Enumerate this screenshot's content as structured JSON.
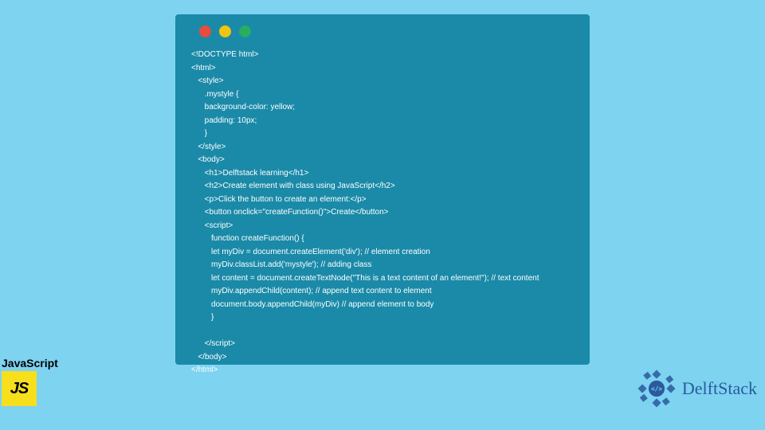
{
  "colors": {
    "page_bg": "#7dd3f0",
    "window_bg": "#1a8aa8",
    "dot_red": "#e74c3c",
    "dot_yellow": "#f1c40f",
    "dot_green": "#27ae60",
    "js_yellow": "#f7df1e",
    "delft_blue": "#2a5a9e"
  },
  "code_lines": [
    "<!DOCTYPE html>",
    "<html>",
    "   <style>",
    "      .mystyle {",
    "      background-color: yellow;",
    "      padding: 10px;",
    "      }",
    "   </style>",
    "   <body>",
    "      <h1>Delftstack learning</h1>",
    "      <h2>Create element with class using JavaScript</h2>",
    "      <p>Click the button to create an element:</p>",
    "      <button onclick=\"createFunction()\">Create</button>",
    "      <script>",
    "         function createFunction() {",
    "         let myDiv = document.createElement('div'); // element creation",
    "         myDiv.classList.add('mystyle'); // adding class",
    "         let content = document.createTextNode(\"This is a text content of an element!\"); // text content",
    "         myDiv.appendChild(content); // append text content to element",
    "         document.body.appendChild(myDiv) // append element to body",
    "         }",
    "          ",
    "      </script>",
    "   </body>",
    "</html>"
  ],
  "js_badge": {
    "label": "JavaScript",
    "logo_text": "JS"
  },
  "delftstack": {
    "text": "DelftStack",
    "icon": "code-brackets-gear"
  }
}
